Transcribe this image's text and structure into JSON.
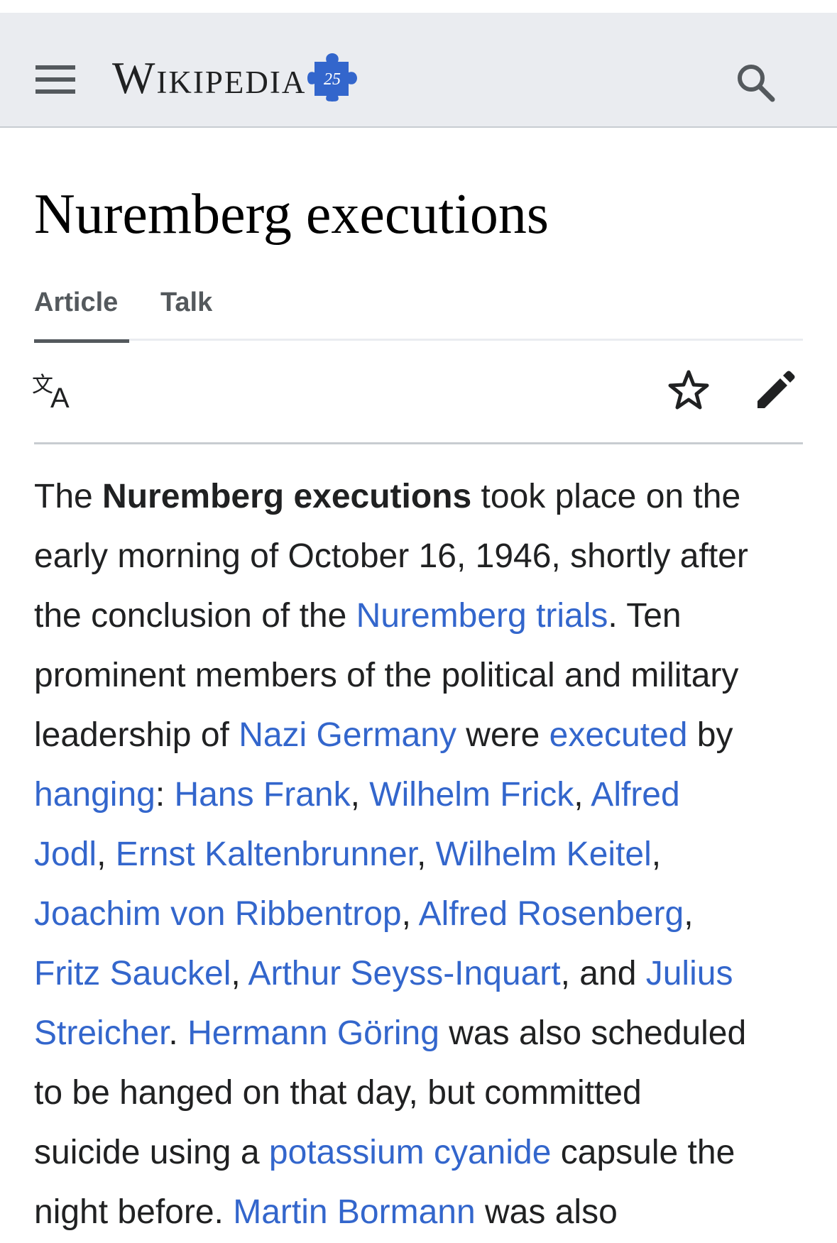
{
  "header": {
    "wordmark": "Wikipedia",
    "anniversary_badge": "25",
    "menu_icon": "hamburger-menu-icon",
    "search_icon": "magnifier-search-icon"
  },
  "page": {
    "title": "Nuremberg executions"
  },
  "tabs": [
    {
      "label": "Article",
      "selected": true
    },
    {
      "label": "Talk",
      "selected": false
    }
  ],
  "actions": {
    "language_icon": "language-translate-icon",
    "watch_icon": "star-watch-icon",
    "edit_icon": "pencil-edit-icon"
  },
  "colors": {
    "link": "#3366cc",
    "header_bg": "#eaecf0",
    "text": "#202122",
    "puzzle": "#3366cc"
  },
  "article": {
    "l1": {
      "t1": "The ",
      "b1": "Nuremberg executions",
      "t2": " took place on the"
    },
    "l2": {
      "t1": "early morning of October 16, 1946, shortly after"
    },
    "l3": {
      "t1": "the conclusion of the ",
      "a1": "Nuremberg trials",
      "t2": ". Ten"
    },
    "l4": {
      "t1": "prominent members of the political and military"
    },
    "l5": {
      "t1": "leadership of ",
      "a1": "Nazi Germany",
      "t2": " were ",
      "a2": "executed",
      "t3": " by"
    },
    "l6": {
      "a1": "hanging",
      "t1": ": ",
      "a2": "Hans Frank",
      "t2": ", ",
      "a3": "Wilhelm Frick",
      "t3": ", ",
      "a4": "Alfred"
    },
    "l7": {
      "a1": "Jodl",
      "t1": ", ",
      "a2": "Ernst Kaltenbrunner",
      "t2": ", ",
      "a3": "Wilhelm Keitel",
      "t3": ","
    },
    "l8": {
      "a1": "Joachim von Ribbentrop",
      "t1": ", ",
      "a2": "Alfred Rosenberg",
      "t2": ","
    },
    "l9": {
      "a1": "Fritz Sauckel",
      "t1": ", ",
      "a2": "Arthur Seyss-Inquart",
      "t2": ", and ",
      "a3": "Julius"
    },
    "l10": {
      "a1": "Streicher",
      "t1": ". ",
      "a2": "Hermann Göring",
      "t2": " was also scheduled"
    },
    "l11": {
      "t1": "to be hanged on that day, but committed"
    },
    "l12": {
      "t1": "suicide using a ",
      "a1": "potassium cyanide",
      "t2": " capsule the"
    },
    "l13": {
      "t1": "night before. ",
      "a1": "Martin Bormann",
      "t2": " was also"
    }
  }
}
